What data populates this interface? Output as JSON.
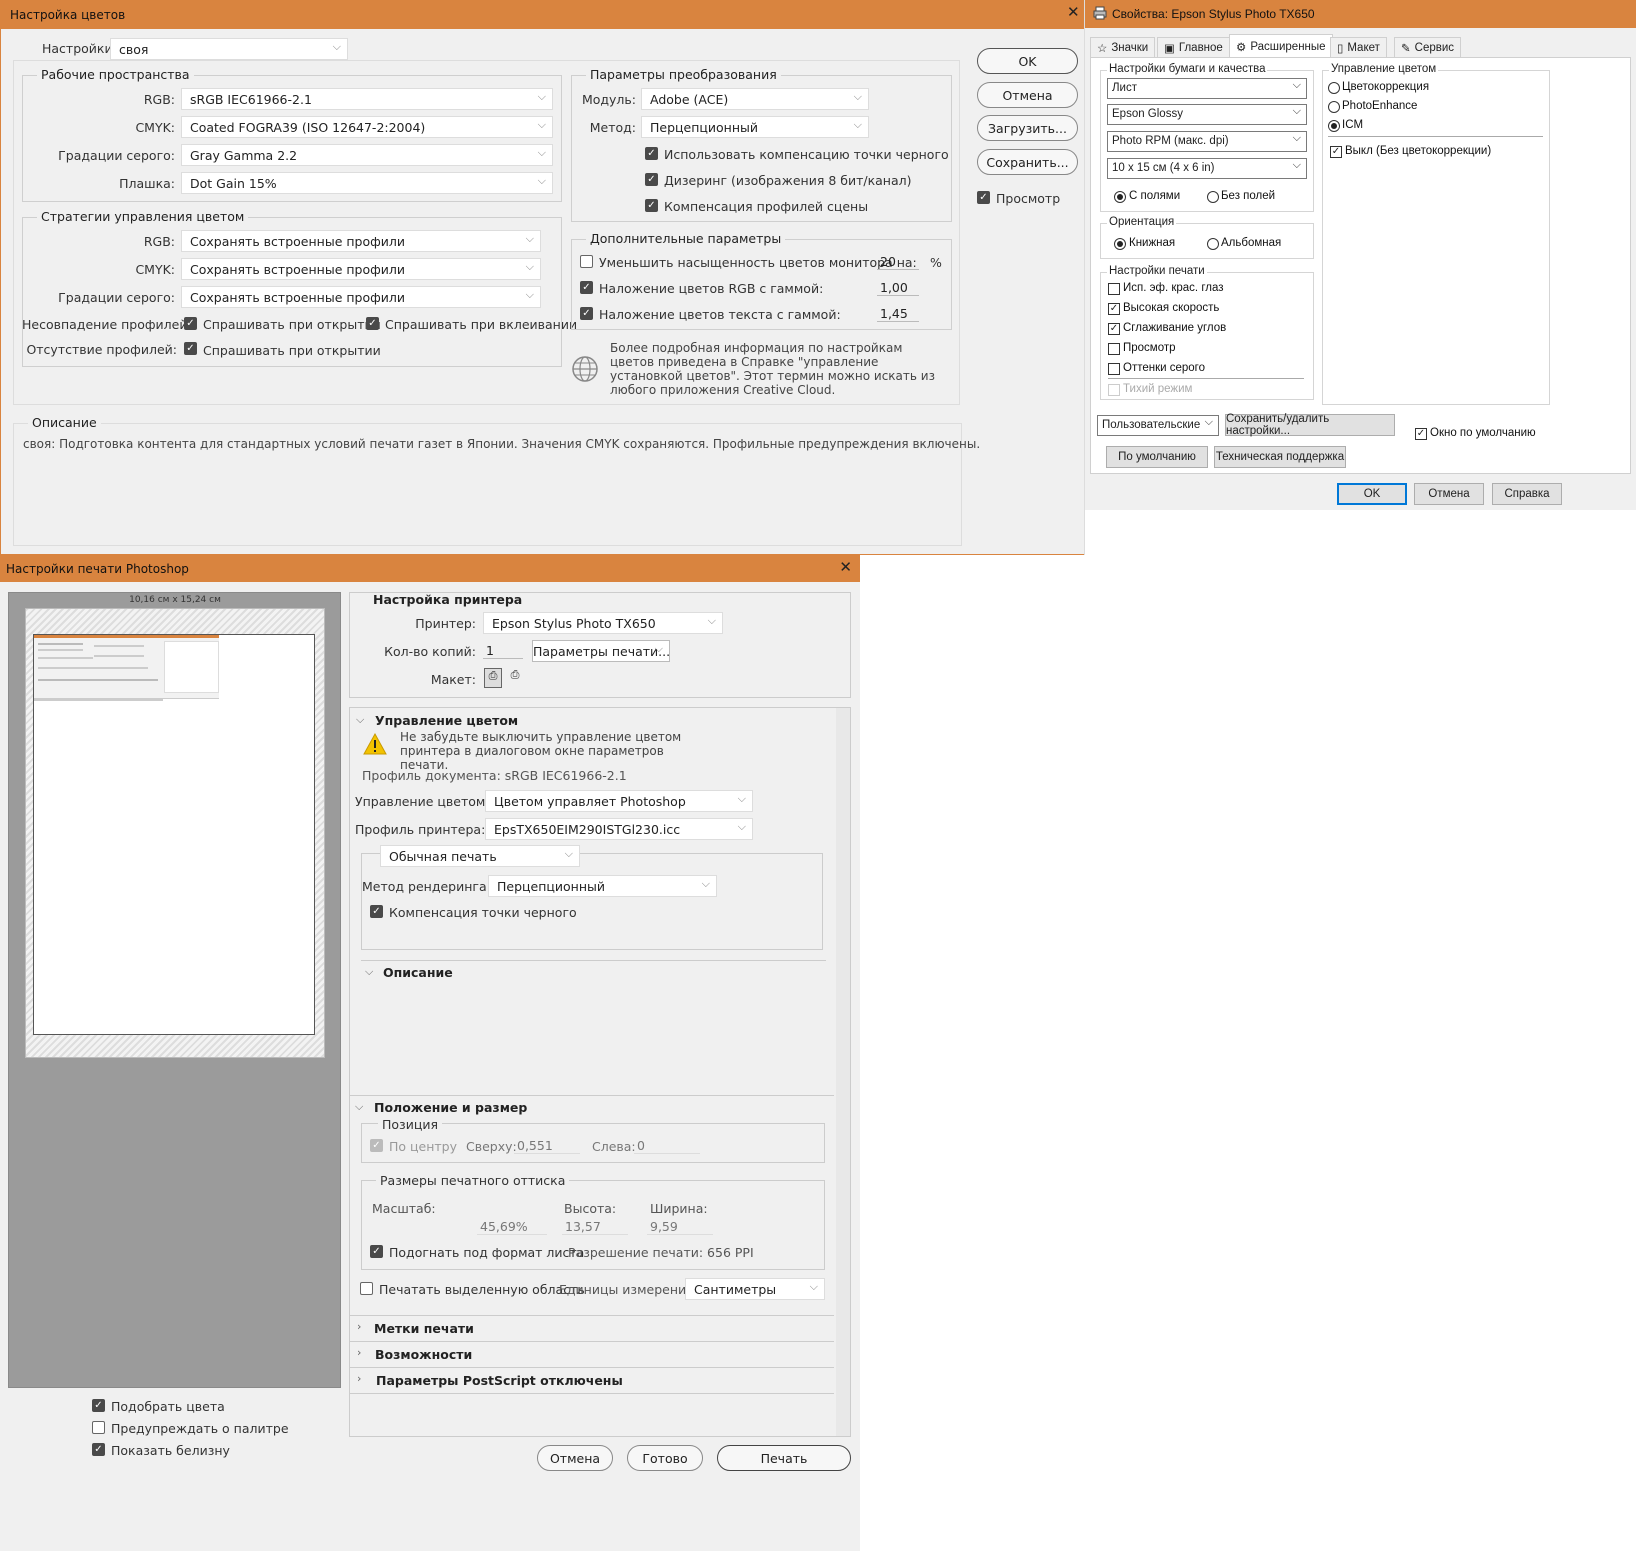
{
  "color_settings": {
    "title": "Настройка цветов",
    "settings_label": "Настройки:",
    "settings_value": "своя",
    "working_spaces": {
      "title": "Рабочие пространства",
      "rgb_label": "RGB:",
      "rgb_value": "sRGB IEC61966-2.1",
      "cmyk_label": "CMYK:",
      "cmyk_value": "Coated FOGRA39 (ISO 12647-2:2004)",
      "gray_label": "Градации серого:",
      "gray_value": "Gray Gamma 2.2",
      "spot_label": "Плашка:",
      "spot_value": "Dot Gain 15%"
    },
    "policies": {
      "title": "Стратегии управления цветом",
      "rgb_label": "RGB:",
      "rgb_value": "Сохранять встроенные профили",
      "cmyk_label": "CMYK:",
      "cmyk_value": "Сохранять встроенные профили",
      "gray_label": "Градации серого:",
      "gray_value": "Сохранять встроенные профили",
      "mismatch_label": "Несовпадение профилей:",
      "mismatch_open": "Спрашивать при открытии",
      "mismatch_paste": "Спрашивать при вклеивании",
      "missing_label": "Отсутствие профилей:",
      "missing_open": "Спрашивать при открытии"
    },
    "conversion": {
      "title": "Параметры преобразования",
      "engine_label": "Модуль:",
      "engine_value": "Adobe (ACE)",
      "intent_label": "Метод:",
      "intent_value": "Перцепционный",
      "bpc": "Использовать компенсацию точки черного",
      "dither": "Дизеринг (изображения 8 бит/канал)",
      "scene": "Компенсация профилей сцены"
    },
    "advanced": {
      "title": "Дополнительные параметры",
      "desaturate": "Уменьшить насыщенность цветов монитора на:",
      "desaturate_value": "20",
      "percent": "%",
      "blend_rgb": "Наложение цветов RGB с гаммой:",
      "blend_rgb_value": "1,00",
      "blend_text": "Наложение цветов текста с гаммой:",
      "blend_text_value": "1,45"
    },
    "info_text": "Более подробная информация по настройкам цветов приведена в Справке \"управление установкой цветов\". Этот термин можно искать из любого приложения Creative Cloud.",
    "description": {
      "title": "Описание",
      "text": "своя:  Подготовка контента для стандартных условий печати газет в Японии. Значения CMYK сохраняются. Профильные предупреждения включены."
    },
    "buttons": {
      "ok": "OK",
      "cancel": "Отмена",
      "load": "Загрузить...",
      "save": "Сохранить..."
    },
    "preview": "Просмотр"
  },
  "epson": {
    "title": "Свойства: Epson Stylus Photo TX650",
    "tabs": [
      "Значки",
      "Главное",
      "Расширенные",
      "Макет",
      "Сервис"
    ],
    "paper_quality": {
      "title": "Настройки бумаги и качества",
      "source": "Лист",
      "type": "Epson Glossy",
      "quality": "Photo RPM (макс. dpi)",
      "size": "10 x 15 см (4 x 6 in)",
      "borders": "С полями",
      "borderless": "Без полей"
    },
    "orientation": {
      "title": "Ориентация",
      "portrait": "Книжная",
      "landscape": "Альбомная"
    },
    "print_opts": {
      "title": "Настройки печати",
      "items": [
        "Исп. эф. крас. глаз",
        "Высокая скорость",
        "Сглаживание углов",
        "Просмотр",
        "Оттенки серого",
        "Тихий режим"
      ]
    },
    "color_mgmt": {
      "title": "Управление цветом",
      "color_controls": "Цветокоррекция",
      "photoenhance": "PhotoEnhance",
      "icm": "ICM",
      "off": "Выкл (Без цветокоррекции)"
    },
    "custom": "Пользовательские",
    "save_del": "Сохранить/удалить настройки...",
    "default_window": "Окно по умолчанию",
    "defaults": "По умолчанию",
    "support": "Техническая поддержка",
    "ok": "OK",
    "cancel": "Отмена",
    "help": "Справка"
  },
  "print": {
    "title": "Настройки печати Photoshop",
    "preview_size": "10,16 см х 15,24 см",
    "match_colors": "Подобрать цвета",
    "gamut_warning": "Предупреждать о палитре",
    "show_white": "Показать белизну",
    "printer_setup": {
      "title": "Настройка принтера",
      "printer_label": "Принтер:",
      "printer_value": "Epson Stylus Photo TX650",
      "copies_label": "Кол-во копий:",
      "copies_value": "1",
      "print_settings": "Параметры печати...",
      "layout_label": "Макет:"
    },
    "color_management": {
      "title": "Управление цветом",
      "warning": "Не забудьте выключить управление цветом принтера в диалоговом окне параметров печати.",
      "doc_profile": "Профиль документа: sRGB IEC61966-2.1",
      "handling_label": "Управление цветом:",
      "handling_value": "Цветом управляет Photoshop",
      "profile_label": "Профиль принтера:",
      "profile_value": "EpsTX650EIM290ISTGl230.icc",
      "normal": "Обычная печать",
      "intent_label": "Метод рендеринга:",
      "intent_value": "Перцепционный",
      "bpc": "Компенсация точки черного"
    },
    "description_title": "Описание",
    "position_size": {
      "title": "Положение и размер",
      "position": "Позиция",
      "center": "По центру",
      "top_label": "Сверху:",
      "top_value": "0,551",
      "left_label": "Слева:",
      "left_value": "0",
      "scaled": "Размеры печатного оттиска",
      "scale_label": "Масштаб:",
      "scale_value": "45,69%",
      "height_label": "Высота:",
      "height_value": "13,57",
      "width_label": "Ширина:",
      "width_value": "9,59",
      "fit": "Подогнать под формат листа",
      "resolution": "Разрешение печати: 656 PPI",
      "print_selected": "Печатать выделенную область",
      "units_label": "Единицы измерения:",
      "units_value": "Сантиметры"
    },
    "sections": [
      "Метки печати",
      "Возможности",
      "Параметры PostScript отключены"
    ],
    "cancel": "Отмена",
    "done": "Готово",
    "print_btn": "Печать"
  }
}
